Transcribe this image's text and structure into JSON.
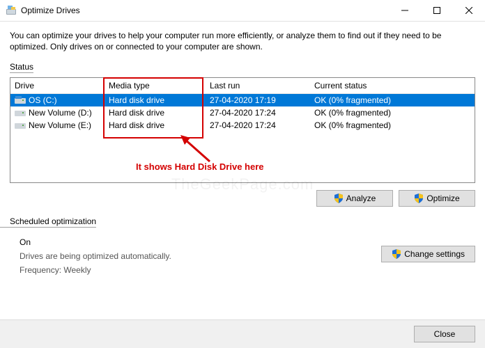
{
  "window": {
    "title": "Optimize Drives"
  },
  "description": "You can optimize your drives to help your computer run more efficiently, or analyze them to find out if they need to be optimized. Only drives on or connected to your computer are shown.",
  "status_label": "Status",
  "columns": {
    "drive": "Drive",
    "media": "Media type",
    "lastrun": "Last run",
    "status": "Current status"
  },
  "drives": [
    {
      "name": "OS (C:)",
      "media": "Hard disk drive",
      "lastrun": "27-04-2020 17:19",
      "status": "OK (0% fragmented)",
      "selected": true,
      "os": true
    },
    {
      "name": "New Volume (D:)",
      "media": "Hard disk drive",
      "lastrun": "27-04-2020 17:24",
      "status": "OK (0% fragmented)",
      "selected": false,
      "os": false
    },
    {
      "name": "New Volume (E:)",
      "media": "Hard disk drive",
      "lastrun": "27-04-2020 17:24",
      "status": "OK (0% fragmented)",
      "selected": false,
      "os": false
    }
  ],
  "annotation": {
    "text": "It shows Hard Disk Drive here"
  },
  "buttons": {
    "analyze": "Analyze",
    "optimize": "Optimize",
    "change_settings": "Change settings",
    "close": "Close"
  },
  "scheduled": {
    "label": "Scheduled optimization",
    "state": "On",
    "line1": "Drives are being optimized automatically.",
    "line2": "Frequency: Weekly"
  },
  "watermark": "TheGeekPage.com"
}
